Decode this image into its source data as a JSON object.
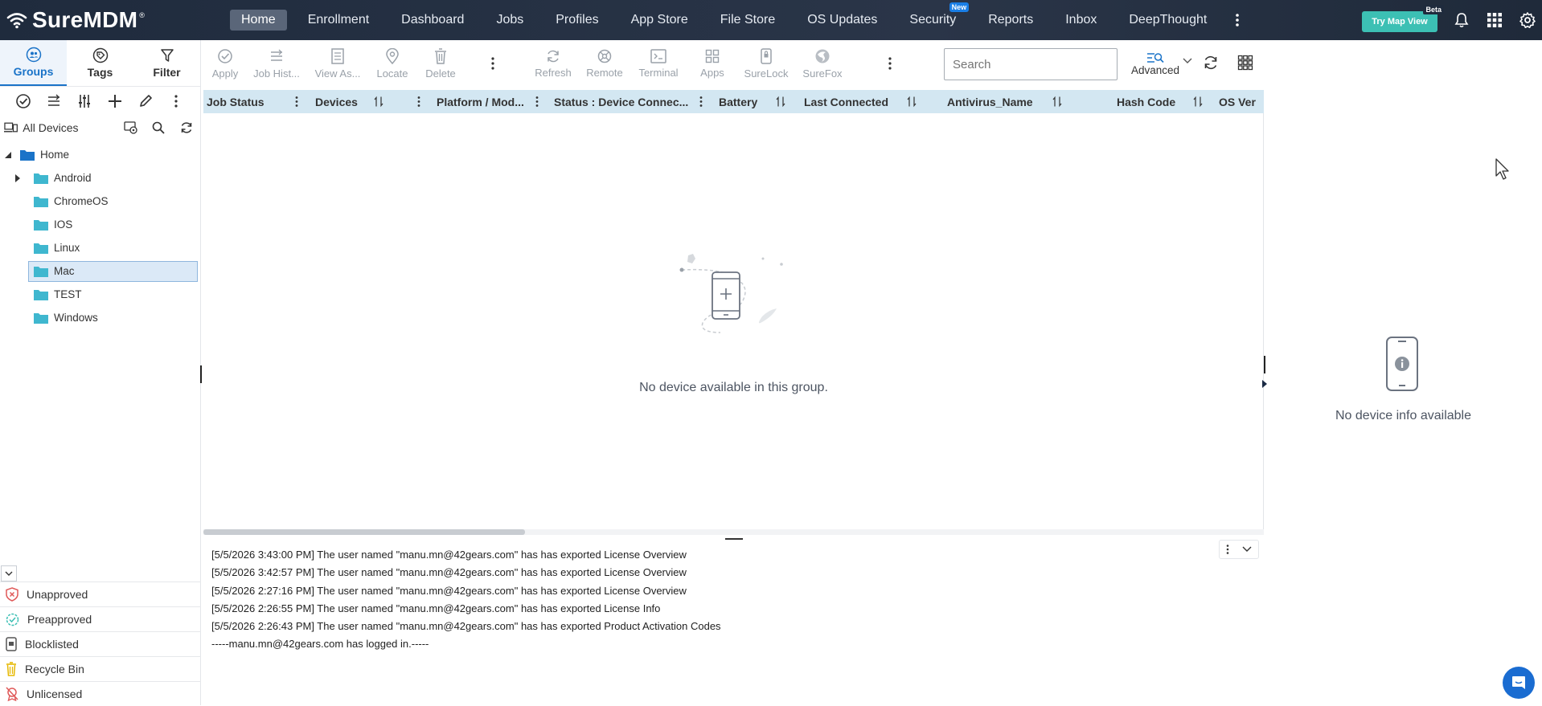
{
  "app": {
    "brand": "SureMDM",
    "registered": "®"
  },
  "nav": {
    "items": [
      {
        "label": "Home",
        "active": true
      },
      {
        "label": "Enrollment"
      },
      {
        "label": "Dashboard"
      },
      {
        "label": "Jobs"
      },
      {
        "label": "Profiles"
      },
      {
        "label": "App Store"
      },
      {
        "label": "File Store"
      },
      {
        "label": "OS Updates"
      },
      {
        "label": "Security",
        "badge": "New"
      },
      {
        "label": "Reports"
      },
      {
        "label": "Inbox"
      },
      {
        "label": "DeepThought"
      }
    ],
    "try_map": "Try Map View",
    "try_map_badge": "Beta"
  },
  "sidebar": {
    "tabs": [
      {
        "label": "Groups",
        "active": true
      },
      {
        "label": "Tags"
      },
      {
        "label": "Filter"
      }
    ],
    "all_devices": "All Devices",
    "tree": {
      "root": "Home",
      "children": [
        "Android",
        "ChromeOS",
        "IOS",
        "Linux",
        "Mac",
        "TEST",
        "Windows"
      ],
      "selected": "Mac"
    },
    "statuses": [
      {
        "label": "Unapproved",
        "color": "#e05a5a"
      },
      {
        "label": "Preapproved",
        "color": "#3cbfb4"
      },
      {
        "label": "Blocklisted",
        "color": "#555555"
      },
      {
        "label": "Recycle Bin",
        "color": "#e6b800"
      },
      {
        "label": "Unlicensed",
        "color": "#e05a5a"
      }
    ]
  },
  "toolbar": {
    "group1": [
      "Apply",
      "Job Hist...",
      "View As...",
      "Locate",
      "Delete"
    ],
    "group2": [
      "Refresh",
      "Remote",
      "Terminal",
      "Apps",
      "SureLock",
      "SureFox"
    ],
    "search_placeholder": "Search",
    "advanced": "Advanced"
  },
  "grid": {
    "columns": [
      "Job Status",
      "Devices",
      "Platform / Mod...",
      "Status : Device Connec...",
      "Battery",
      "Last Connected",
      "Antivirus_Name",
      "Hash Code",
      "OS Ver"
    ],
    "empty_message": "No device available in this group."
  },
  "log": {
    "lines": [
      "[5/5/2026 3:43:00 PM] The user named \"manu.mn@42gears.com\" has has exported License Overview",
      "[5/5/2026 3:42:57 PM] The user named \"manu.mn@42gears.com\" has has exported License Overview",
      "[5/5/2026 2:27:16 PM] The user named \"manu.mn@42gears.com\" has has exported License Overview",
      "[5/5/2026 2:26:55 PM] The user named \"manu.mn@42gears.com\" has has exported License Info",
      "[5/5/2026 2:26:43 PM] The user named \"manu.mn@42gears.com\" has has exported Product Activation Codes",
      "-----manu.mn@42gears.com has logged in.-----"
    ]
  },
  "info_panel": {
    "empty_message": "No device info available"
  },
  "colors": {
    "nav_bg": "#232f41",
    "accent": "#1a73c8",
    "try_map": "#3cc0b4",
    "folder": "#3fb7cf",
    "grid_header": "#d3e7f2"
  }
}
